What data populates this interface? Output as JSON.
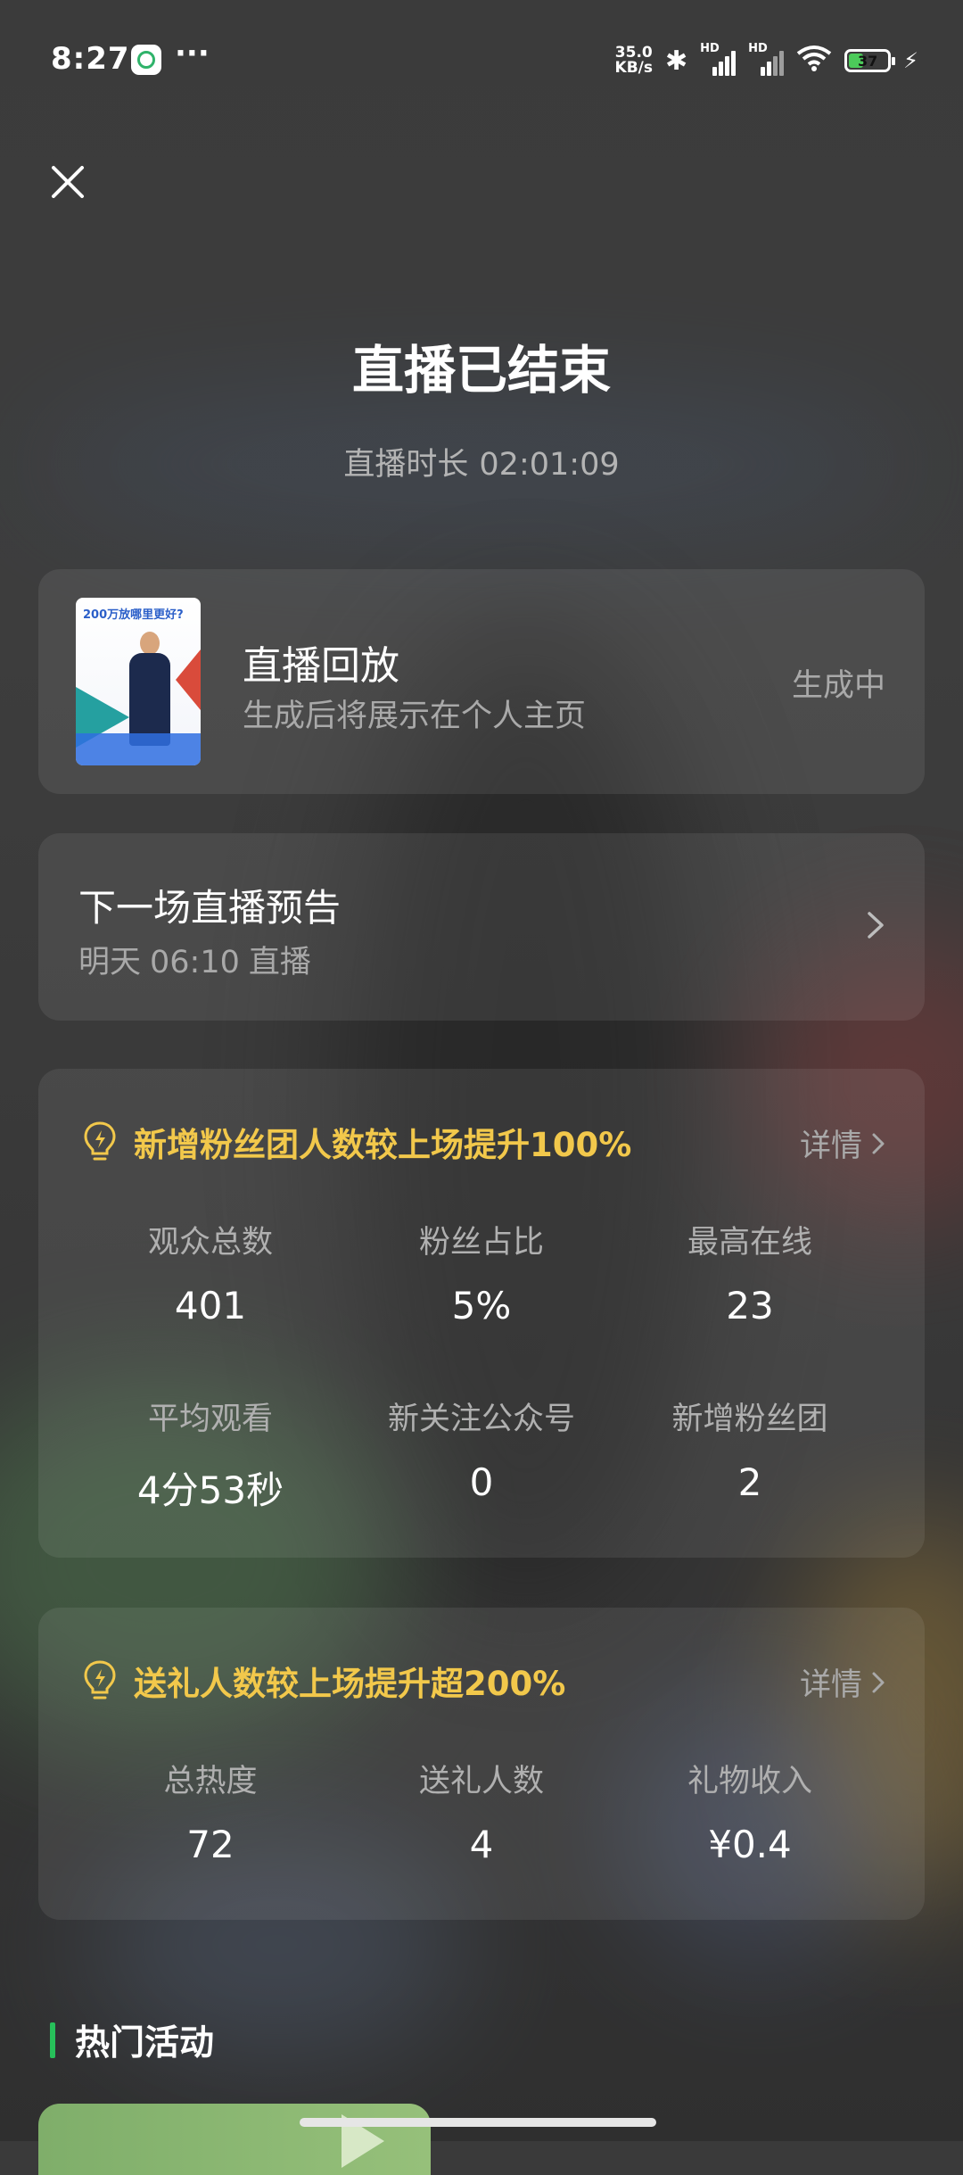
{
  "status_bar": {
    "time": "8:27",
    "menu_dots": "···",
    "net_speed_value": "35.0",
    "net_speed_unit": "KB/s",
    "signal_label": "HD",
    "wifi_sub": "6",
    "battery": "37",
    "battery_level": 0.37
  },
  "header": {
    "title": "直播已结束",
    "duration_label": "直播时长",
    "duration_value": "02:01:09"
  },
  "replay": {
    "title": "直播回放",
    "subtitle": "生成后将展示在个人主页",
    "status": "生成中",
    "thumbnail_headline": "200万放哪里更好?"
  },
  "next_live": {
    "title": "下一场直播预告",
    "day": "明天",
    "time": "06:10",
    "suffix": "直播"
  },
  "stats_card": {
    "tip": "新增粉丝团人数较上场提升100%",
    "detail": "详情",
    "items": [
      {
        "label": "观众总数",
        "value": "401"
      },
      {
        "label": "粉丝占比",
        "value": "5%"
      },
      {
        "label": "最高在线",
        "value": "23"
      },
      {
        "label": "平均观看",
        "value": "4分53秒"
      },
      {
        "label": "新关注公众号",
        "value": "0"
      },
      {
        "label": "新增粉丝团",
        "value": "2"
      }
    ]
  },
  "gift_card": {
    "tip": "送礼人数较上场提升超200%",
    "detail": "详情",
    "items": [
      {
        "label": "总热度",
        "value": "72"
      },
      {
        "label": "送礼人数",
        "value": "4"
      },
      {
        "label": "礼物收入",
        "value": "¥0.4"
      }
    ]
  },
  "section": {
    "hot_activities": "热门活动"
  },
  "colors": {
    "accent_yellow": "#f2c84b",
    "accent_green": "#27c05a",
    "muted_text": "#a9a9a9"
  }
}
